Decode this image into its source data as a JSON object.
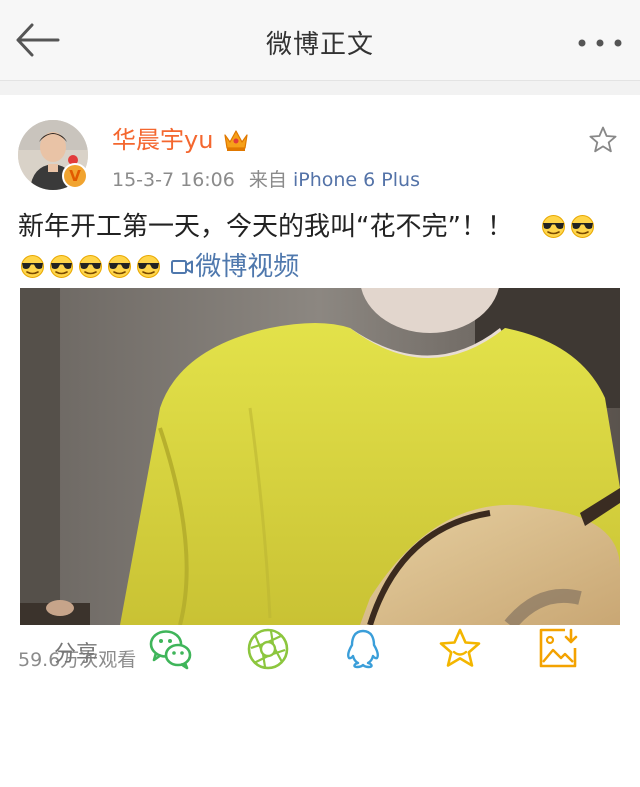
{
  "nav": {
    "title": "微博正文"
  },
  "post": {
    "username": "华晨宇yu",
    "timestamp": "15-3-7 16:06",
    "source_label": "来自",
    "source_device": "iPhone 6 Plus",
    "text": "新年开工第一天，今天的我叫“花不完”！！",
    "video_link_label": "微博视频",
    "view_count": "59.6万次观看",
    "verified_mark": "V"
  },
  "share": {
    "label": "分享",
    "targets": [
      "wechat-icon",
      "moments-icon",
      "qq-icon",
      "favorite-icon",
      "save-image-icon"
    ]
  },
  "colors": {
    "username": "#f4672f",
    "link": "#5473a8",
    "video_link": "#4f78ad",
    "wechat": "#3fb55a",
    "moments": "#8cc63e",
    "qq": "#3a9ed9",
    "favorite": "#f3b600",
    "save": "#f3a200"
  }
}
